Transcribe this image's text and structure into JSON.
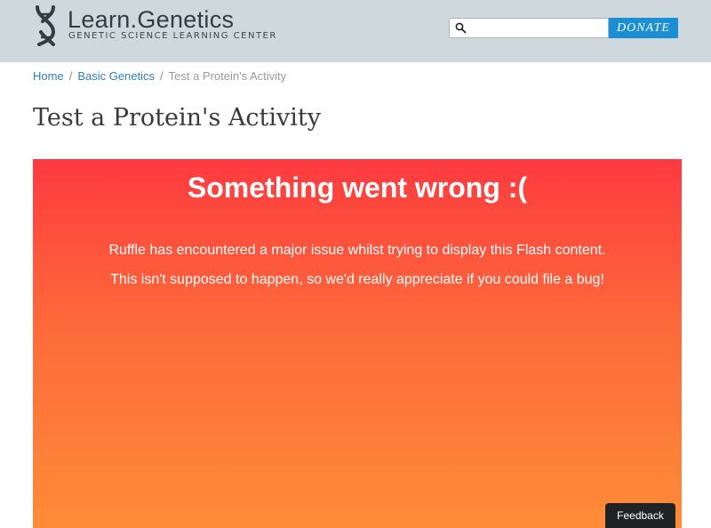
{
  "header": {
    "logo": {
      "title": "Learn.Genetics",
      "subtitle": "GENETIC SCIENCE LEARNING CENTER",
      "icon": "dna-icon"
    },
    "search": {
      "placeholder": "",
      "value": "",
      "icon": "search-icon"
    },
    "donate_label": "DONATE",
    "colors": {
      "header_bg": "#cfd8dc",
      "donate_bg": "#1a8fd6"
    }
  },
  "breadcrumb": {
    "items": [
      {
        "label": "Home"
      },
      {
        "label": "Basic Genetics"
      }
    ],
    "separator": "/",
    "current": "Test a Protein's Activity"
  },
  "page_title": "Test a Protein's Activity",
  "flash_error": {
    "title": "Something went wrong :(",
    "messages": [
      "Ruffle has encountered a major issue whilst trying to display this Flash content.",
      "This isn't supposed to happen, so we'd really appreciate if you could file a bug!"
    ],
    "colors": {
      "gradient_top": "#fd3a40",
      "gradient_bottom": "#ff8c38"
    }
  },
  "feedback_label": "Feedback"
}
